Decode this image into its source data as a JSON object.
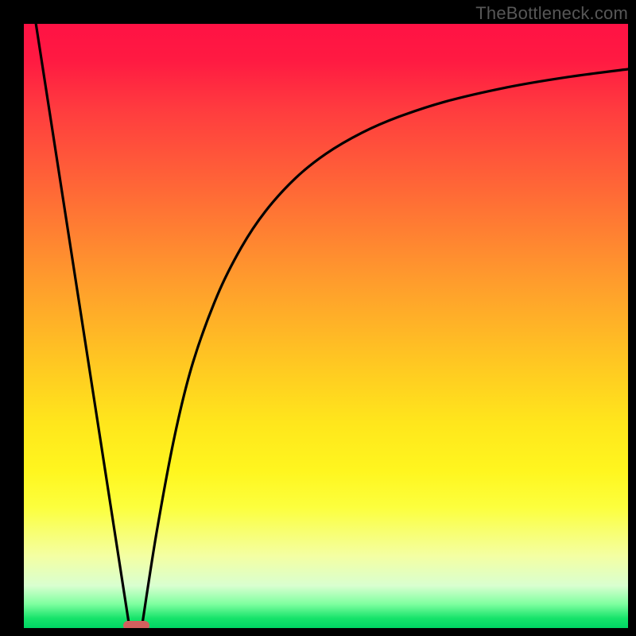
{
  "watermark": "TheBottleneck.com",
  "chart_data": {
    "type": "line",
    "title": "",
    "xlabel": "",
    "ylabel": "",
    "xlim": [
      0,
      100
    ],
    "ylim": [
      0,
      100
    ],
    "grid": false,
    "legend": false,
    "series": [
      {
        "name": "left-descent",
        "x": [
          2,
          17.5
        ],
        "y": [
          100,
          0
        ]
      },
      {
        "name": "right-curve",
        "x": [
          19.5,
          22,
          25,
          28,
          32,
          36,
          40,
          45,
          50,
          56,
          62,
          70,
          80,
          90,
          100
        ],
        "y": [
          0,
          16,
          32,
          44,
          55,
          63,
          69,
          74.5,
          78.5,
          82,
          84.6,
          87.2,
          89.5,
          91.2,
          92.5
        ]
      }
    ],
    "marker": {
      "name": "bottleneck-band",
      "x_start": 16.4,
      "x_end": 20.8,
      "y": 0,
      "color": "#d2605e"
    },
    "background_gradient": {
      "direction": "vertical",
      "stops": [
        {
          "pos": 0.0,
          "color": "#ff1244"
        },
        {
          "pos": 0.28,
          "color": "#ff6a36"
        },
        {
          "pos": 0.56,
          "color": "#ffc722"
        },
        {
          "pos": 0.8,
          "color": "#fcff3d"
        },
        {
          "pos": 0.93,
          "color": "#d9ffd0"
        },
        {
          "pos": 1.0,
          "color": "#00d563"
        }
      ]
    }
  }
}
